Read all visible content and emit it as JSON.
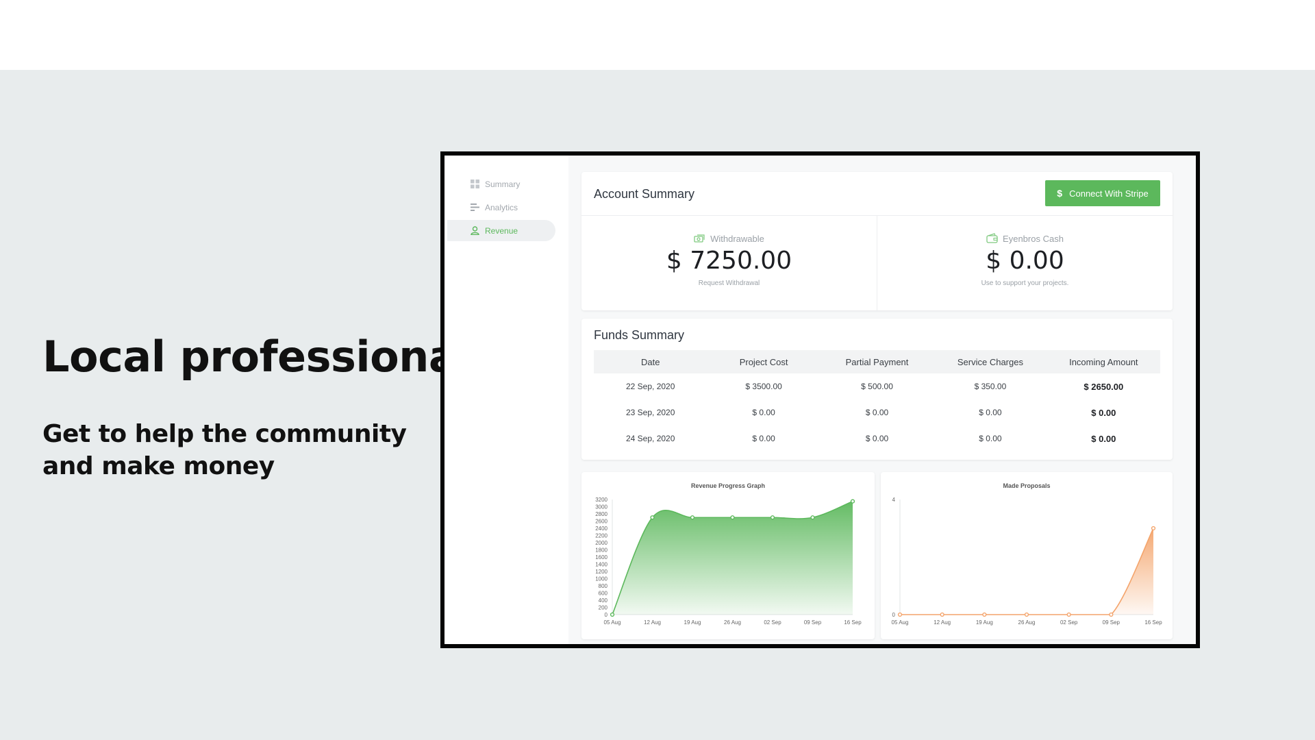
{
  "hero": {
    "title": "Local professionals",
    "subtitle": "Get to help the community and make money"
  },
  "sidebar": {
    "items": [
      {
        "label": "Summary",
        "icon": "grid-icon",
        "active": false
      },
      {
        "label": "Analytics",
        "icon": "bars-icon",
        "active": false
      },
      {
        "label": "Revenue",
        "icon": "user-icon",
        "active": true
      }
    ]
  },
  "account": {
    "title": "Account Summary",
    "button_label": "Connect With Stripe",
    "button_icon": "$",
    "withdrawable": {
      "label": "Withdrawable",
      "amount": "$ 7250.00",
      "note": "Request Withdrawal",
      "icon": "money-icon"
    },
    "cash": {
      "label": "Eyenbros Cash",
      "amount": "$ 0.00",
      "note": "Use to support your projects.",
      "icon": "wallet-icon"
    }
  },
  "funds": {
    "title": "Funds Summary",
    "columns": [
      "Date",
      "Project Cost",
      "Partial Payment",
      "Service Charges",
      "Incoming Amount"
    ],
    "rows": [
      [
        "22 Sep, 2020",
        "$ 3500.00",
        "$ 500.00",
        "$ 350.00",
        "$ 2650.00"
      ],
      [
        "23 Sep, 2020",
        "$ 0.00",
        "$ 0.00",
        "$ 0.00",
        "$ 0.00"
      ],
      [
        "24 Sep, 2020",
        "$ 0.00",
        "$ 0.00",
        "$ 0.00",
        "$ 0.00"
      ]
    ]
  },
  "colors": {
    "accent": "#5cb85c",
    "orange": "#f4a46b"
  },
  "chart_data": [
    {
      "type": "area",
      "title": "Revenue Progress Graph",
      "x": [
        "05 Aug",
        "12 Aug",
        "19 Aug",
        "26 Aug",
        "02 Sep",
        "09 Sep",
        "16 Sep"
      ],
      "series": [
        {
          "values": [
            0,
            2700,
            2700,
            2700,
            2700,
            2700,
            3150
          ]
        }
      ],
      "yticks": [
        0,
        200,
        400,
        600,
        800,
        1000,
        1200,
        1400,
        1600,
        1800,
        2000,
        2200,
        2400,
        2600,
        2800,
        3000,
        3200
      ],
      "ylim": [
        0,
        3200
      ],
      "color": "#5cb85c"
    },
    {
      "type": "area",
      "title": "Made Proposals",
      "x": [
        "05 Aug",
        "12 Aug",
        "19 Aug",
        "26 Aug",
        "02 Sep",
        "09 Sep",
        "16 Sep"
      ],
      "series": [
        {
          "values": [
            0,
            0,
            0,
            0,
            0,
            0,
            3
          ]
        }
      ],
      "yticks": [
        0,
        4
      ],
      "ylim": [
        0,
        4
      ],
      "color": "#f4a46b"
    }
  ]
}
